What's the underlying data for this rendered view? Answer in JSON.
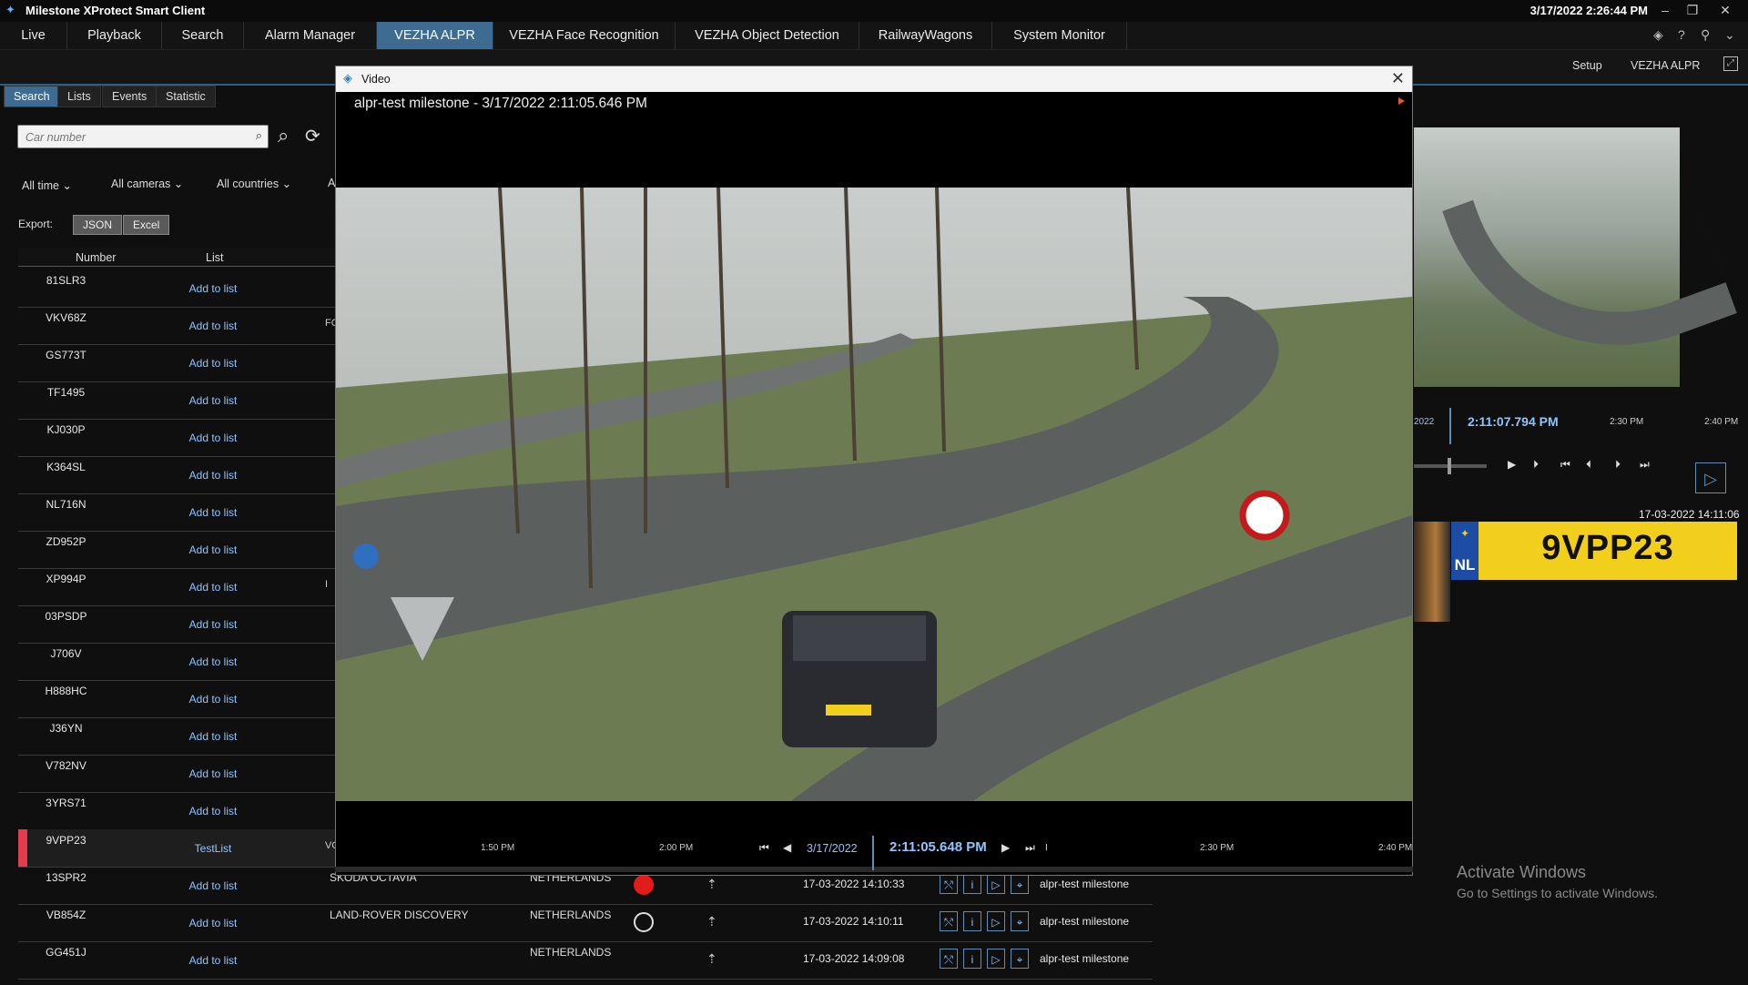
{
  "app": {
    "title": "Milestone XProtect Smart Client",
    "clock": "3/17/2022 2:26:44 PM"
  },
  "menu": {
    "items": [
      "Live",
      "Playback",
      "Search",
      "Alarm Manager",
      "VEZHA ALPR",
      "VEZHA Face Recognition",
      "VEZHA Object Detection",
      "RailwayWagons",
      "System Monitor"
    ],
    "active": "VEZHA ALPR"
  },
  "subbar": {
    "setup": "Setup",
    "module": "VEZHA ALPR"
  },
  "tabs": [
    "Search",
    "Lists",
    "Events",
    "Statistic"
  ],
  "search": {
    "placeholder": "Car number"
  },
  "filters": {
    "time": "All time",
    "cameras": "All cameras",
    "countries": "All countries",
    "more": "A"
  },
  "export": {
    "label": "Export:",
    "json": "JSON",
    "excel": "Excel"
  },
  "table": {
    "headers": {
      "number": "Number",
      "list": "List"
    },
    "rows": [
      {
        "number": "81SLR3",
        "list": "Add to list",
        "clip": ""
      },
      {
        "number": "VKV68Z",
        "list": "Add to list",
        "clip": "FC"
      },
      {
        "number": "GS773T",
        "list": "Add to list",
        "clip": ""
      },
      {
        "number": "TF1495",
        "list": "Add to list",
        "clip": ""
      },
      {
        "number": "KJ030P",
        "list": "Add to list",
        "clip": ""
      },
      {
        "number": "K364SL",
        "list": "Add to list",
        "clip": ""
      },
      {
        "number": "NL716N",
        "list": "Add to list",
        "clip": ""
      },
      {
        "number": "ZD952P",
        "list": "Add to list",
        "clip": ""
      },
      {
        "number": "XP994P",
        "list": "Add to list",
        "clip": "I"
      },
      {
        "number": "03PSDP",
        "list": "Add to list",
        "clip": ""
      },
      {
        "number": "J706V",
        "list": "Add to list",
        "clip": ""
      },
      {
        "number": "H888HC",
        "list": "Add to list",
        "clip": ""
      },
      {
        "number": "J36YN",
        "list": "Add to list",
        "clip": ""
      },
      {
        "number": "V782NV",
        "list": "Add to list",
        "clip": ""
      },
      {
        "number": "3YRS71",
        "list": "Add to list",
        "clip": ""
      },
      {
        "number": "9VPP23",
        "list": "TestList",
        "clip": "VOL"
      }
    ],
    "lower_rows": [
      {
        "number": "13SPR2",
        "list": "Add to list",
        "make": "SKODA OCTAVIA",
        "country": "NETHERLANDS",
        "dot": "red",
        "time": "17-03-2022 14:10:33",
        "source": "alpr-test milestone"
      },
      {
        "number": "VB854Z",
        "list": "Add to list",
        "make": "LAND-ROVER DISCOVERY",
        "country": "NETHERLANDS",
        "dot": "empty",
        "time": "17-03-2022 14:10:11",
        "source": "alpr-test milestone"
      },
      {
        "number": "GG451J",
        "list": "Add to list",
        "make": "",
        "country": "NETHERLANDS",
        "dot": "none",
        "time": "17-03-2022 14:09:08",
        "source": "alpr-test milestone"
      }
    ]
  },
  "video_dialog": {
    "title": "Video",
    "caption": "alpr-test milestone - 3/17/2022 2:11:05.646 PM",
    "timeline": {
      "ticks": [
        "1:50 PM",
        "2:00 PM",
        "2:30 PM",
        "2:40 PM"
      ],
      "date": "3/17/2022",
      "time": "2:11:05.648 PM",
      "marker": "I"
    }
  },
  "right_panel": {
    "timeline": {
      "left_partial": "2022",
      "time": "2:11:07.794 PM",
      "ticks": [
        "2:30 PM",
        "2:40 PM"
      ]
    },
    "detection_time": "17-03-2022 14:11:06",
    "plate": {
      "country": "NL",
      "number": "9VPP23",
      "stars": "✦"
    }
  },
  "watermark": {
    "line1": "Activate Windows",
    "line2": "Go to Settings to activate Windows."
  },
  "colors": {
    "accent": "#3d6b92",
    "link": "#8dc6ff",
    "plate": "#f3cf1d",
    "alert": "#e23c4f"
  }
}
